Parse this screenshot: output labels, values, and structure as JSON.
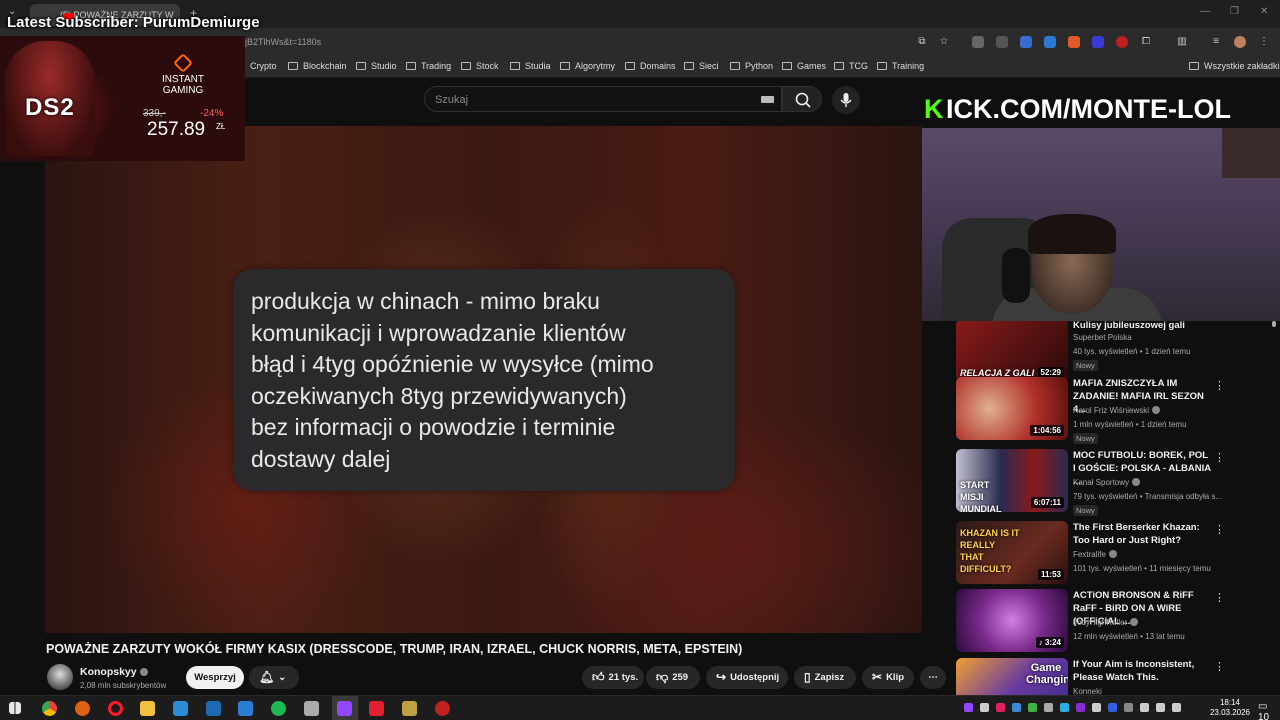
{
  "browser": {
    "tab_title": "(5) POWAŻNE ZARZUTY W",
    "url_fragment": "jB2TlhWs&t=1180s",
    "bookmarks": [
      "Crypto",
      "Blockchain",
      "Studio",
      "Trading",
      "Stock",
      "Studia",
      "Algorytmy",
      "Domains",
      "Sieci",
      "Python",
      "Games",
      "TCG",
      "Training"
    ],
    "all_bookmarks_label": "Wszystkie zakładki"
  },
  "overlay": {
    "subscriber_banner": "Latest Subscriber: PurumDemiurge",
    "ad": {
      "game": "DS2",
      "brand_line1": "INSTANT",
      "brand_line2": "GAMING",
      "old_price": "339,-",
      "discount": "-24%",
      "price": "257.89",
      "currency": "ZŁ"
    },
    "kick": {
      "k": "K",
      "rest": "ICK.COM/MONTE-LOL"
    }
  },
  "header": {
    "search_placeholder": "Szukaj"
  },
  "video": {
    "message": "produkcja w chinach - mimo braku\nkomunikacji i wprowadzanie klientów\nbłąd i 4tyg opóźnienie w wysyłce (mimo\noczekiwanych 8tyg przewidywanych)\nbez informacji o powodzie i terminie\ndostawy dalej",
    "title": "POWAŻNE ZARZUTY WOKÓŁ FIRMY KASIX (DRESSCODE, TRUMP, IRAN, IZRAEL, CHUCK NORRIS, META, EPSTEIN)"
  },
  "channel": {
    "name": "Konopskyy",
    "subs": "2,08 mln subskrybentów",
    "support_label": "Wesprzyj"
  },
  "actions": {
    "likes": "21 tys.",
    "dislikes": "259",
    "share": "Udostępnij",
    "save": "Zapisz",
    "clip": "Klip"
  },
  "sidebar": {
    "items": [
      {
        "title": "Kulisy jubileuszowej gali",
        "channel": "Superbet Polska",
        "meta": "40 tys. wyświetleń • 1 dzień temu",
        "badge": "Nowy",
        "duration": "52:29",
        "thumb_caption": "RELACJA Z GALI",
        "color": "#8a1a1a"
      },
      {
        "title": "MAFIA ZNISZCZYŁA IM ZADANIE! MAFIA IRL SEZON 4...",
        "channel": "Karol Friz Wiśniewski",
        "meta": "1 mln wyświetleń • 1 dzień temu",
        "badge": "Nowy",
        "duration": "1:04:56",
        "thumb_caption": "",
        "color": "#b0302a"
      },
      {
        "title": "MOC FUTBOLU: BOREK, POL I GOŚCIE: POLSKA - ALBANIA ...",
        "channel": "Kanał Sportowy",
        "meta": "79 tys. wyświetleń • Transmisja odbyła s...",
        "badge": "Nowy",
        "duration": "6:07:11",
        "thumb_caption": "START MISJI MUNDIAL",
        "color": "#2a2a50"
      },
      {
        "title": "The First Berserker Khazan: Too Hard or Just Right?",
        "channel": "Fextralife",
        "meta": "101 tys. wyświetleń • 11 miesięcy temu",
        "badge": "",
        "duration": "11:53",
        "thumb_caption": "KHAZAN IS IT REALLY THAT DIFFICULT?",
        "color": "#4a1a20"
      },
      {
        "title": "ACTiON BRONSON & RiFF RaFF - BiRD ON A WiRE (OFFiCiAL ...",
        "channel": "JodyHighRoller",
        "meta": "12 mln wyświetleń • 13 lat temu",
        "badge": "",
        "duration": "3:24",
        "thumb_caption": "",
        "color": "#7a2a8a"
      },
      {
        "title": "If Your Aim is Inconsistent, Please Watch This.",
        "channel": "Konneki",
        "meta": "",
        "badge": "",
        "duration": "",
        "thumb_caption": "Game Changing",
        "color": "#6a3aa0"
      }
    ]
  },
  "taskbar": {
    "time": "18:14",
    "date": "23.03.2026",
    "notifications": "10"
  }
}
